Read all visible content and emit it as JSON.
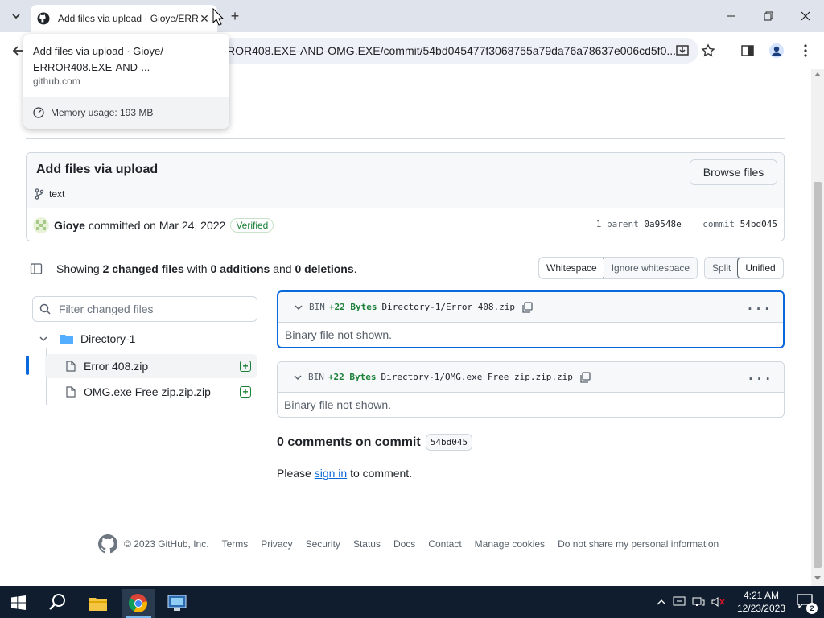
{
  "browser": {
    "tab_title": "Add files via upload · Gioye/ERR",
    "url": "ROR408.EXE-AND-OMG.EXE/commit/54bd045477f3068755a79da76a78637e006cd5f0..."
  },
  "hovercard": {
    "title": "Add files via upload · Gioye/ ERROR408.EXE-AND-...",
    "domain": "github.com",
    "memory": "Memory usage: 193 MB"
  },
  "commit": {
    "title": "Add files via upload",
    "browse_label": "Browse files",
    "branch": "text",
    "author": "Gioye",
    "committed_on": "committed on Mar 24, 2022",
    "verified": "Verified",
    "parent_label": "1 parent",
    "parent_sha": "0a9548e",
    "commit_label": "commit",
    "commit_sha": "54bd045"
  },
  "stats": {
    "showing": "Showing",
    "changed_count": "2 changed files",
    "with": "with",
    "additions": "0 additions",
    "and": "and",
    "deletions": "0 deletions",
    "period": "."
  },
  "view_options": {
    "whitespace": "Whitespace",
    "ignore_whitespace": "Ignore whitespace",
    "split": "Split",
    "unified": "Unified"
  },
  "file_tree": {
    "filter_placeholder": "Filter changed files",
    "directory": "Directory-1",
    "files": [
      {
        "name": "Error 408.zip"
      },
      {
        "name": "OMG.exe Free zip.zip.zip"
      }
    ]
  },
  "diffs": [
    {
      "type": "BIN",
      "bytes": "+22 Bytes",
      "path": "Directory-1/Error 408.zip",
      "body": "Binary file not shown."
    },
    {
      "type": "BIN",
      "bytes": "+22 Bytes",
      "path": "Directory-1/OMG.exe Free zip.zip.zip",
      "body": "Binary file not shown."
    }
  ],
  "comments": {
    "title": "0 comments on commit",
    "sha": "54bd045",
    "please": "Please",
    "sign_in": "sign in",
    "to_comment": "to comment."
  },
  "footer": {
    "copyright": "© 2023 GitHub, Inc.",
    "links": [
      "Terms",
      "Privacy",
      "Security",
      "Status",
      "Docs",
      "Contact",
      "Manage cookies",
      "Do not share my personal information"
    ]
  },
  "taskbar": {
    "time": "4:21 AM",
    "date": "12/23/2023",
    "notification_count": "2"
  }
}
